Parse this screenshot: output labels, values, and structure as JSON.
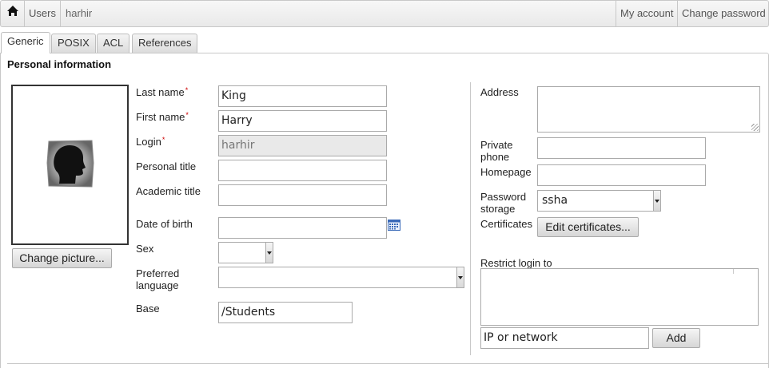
{
  "topbar": {
    "home_icon": "home-icon",
    "users_label": "Users",
    "breadcrumb": "harhir",
    "my_account_label": "My account",
    "change_password_label": "Change password"
  },
  "tabs": [
    {
      "label": "Generic",
      "active": true
    },
    {
      "label": "POSIX",
      "active": false
    },
    {
      "label": "ACL",
      "active": false
    },
    {
      "label": "References",
      "active": false
    }
  ],
  "section": {
    "title": "Personal information"
  },
  "picture": {
    "icon": "user-silhouette-icon",
    "button_label": "Change picture..."
  },
  "form": {
    "last_name": {
      "label": "Last name",
      "required": "*",
      "value": "King"
    },
    "first_name": {
      "label": "First name",
      "required": "*",
      "value": "Harry"
    },
    "login": {
      "label": "Login",
      "required": "*",
      "value": "harhir"
    },
    "personal_title": {
      "label": "Personal title",
      "value": ""
    },
    "academic_title": {
      "label": "Academic title",
      "value": ""
    },
    "date_of_birth": {
      "label": "Date of birth",
      "value": "",
      "icon": "calendar-icon"
    },
    "sex": {
      "label": "Sex",
      "value": ""
    },
    "preferred_language": {
      "label": "Preferred language",
      "value": ""
    },
    "base": {
      "label": "Base",
      "value": "/Students"
    }
  },
  "right": {
    "address": {
      "label": "Address",
      "value": ""
    },
    "private_phone": {
      "label": "Private phone",
      "value": ""
    },
    "homepage": {
      "label": "Homepage",
      "value": ""
    },
    "password_storage": {
      "label": "Password storage",
      "value": "ssha"
    },
    "certificates": {
      "label": "Certificates",
      "button_label": "Edit certificates..."
    },
    "restrict_login": {
      "label": "Restrict login to",
      "input_value": "IP or network",
      "add_label": "Add"
    }
  },
  "colors": {
    "required": "#cc0000",
    "border": "#aaaaaa",
    "disabled_bg": "#e9e9e9"
  }
}
